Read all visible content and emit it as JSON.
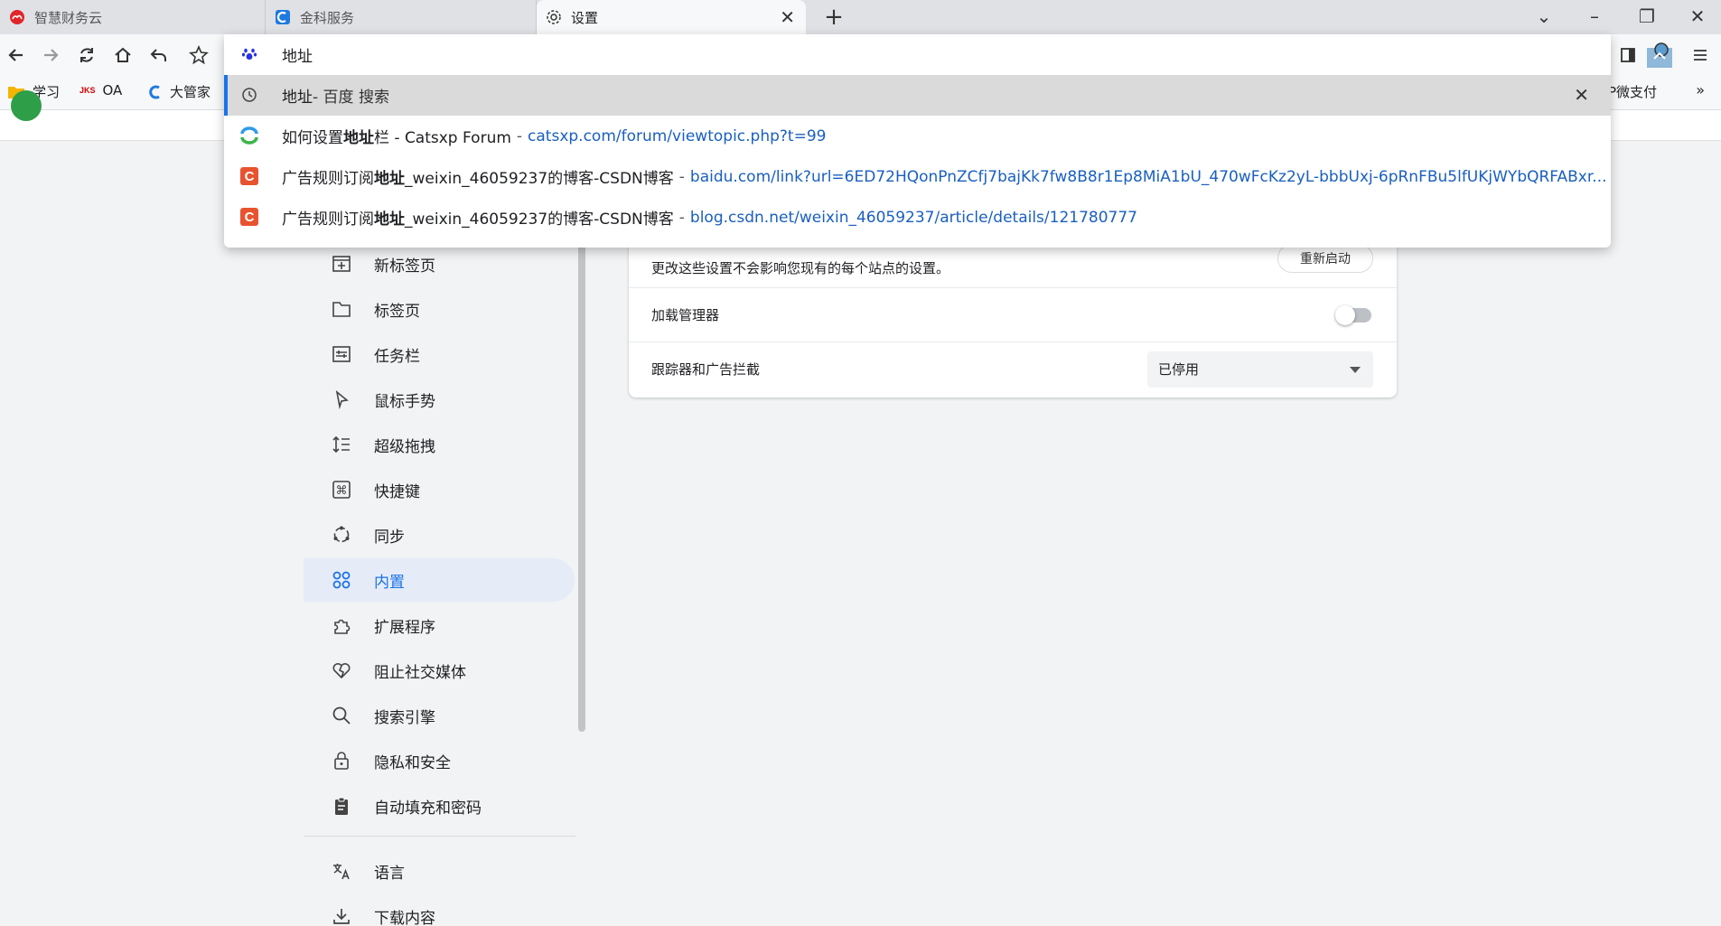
{
  "tabs": [
    {
      "title": "智慧财务云",
      "icon": "cloud-logo-icon"
    },
    {
      "title": "金科服务",
      "icon": "kingdee-logo-icon"
    },
    {
      "title": "设置",
      "icon": "gear-icon",
      "active": true
    }
  ],
  "toolbar": {
    "back": "back-icon",
    "forward": "forward-icon",
    "reload": "reload-icon",
    "home": "home-icon",
    "undo": "undo-icon",
    "star": "star-icon"
  },
  "bookmarks": [
    {
      "label": "学习",
      "icon": "folder-icon"
    },
    {
      "label": "OA",
      "icon": "jks-logo-icon",
      "badge": "JKS"
    },
    {
      "label": "大管家",
      "icon": "kingdee-logo-icon"
    },
    {
      "label": "P微支付",
      "icon": "partial"
    }
  ],
  "bookmarks_more": "»",
  "omnibox": {
    "input_text": "地址",
    "suggestions": [
      {
        "icon": "history-icon",
        "prefix": "地址",
        "title": " - 百度 搜索",
        "url": "",
        "selected": true
      },
      {
        "icon": "catsxp-logo-icon",
        "prefix": "如何设置",
        "bold": "地址",
        "title": "栏 - Catsxp Forum",
        "url": "catsxp.com/forum/viewtopic.php?t=99"
      },
      {
        "icon": "csdn-logo-icon",
        "prefix": "广告规则订阅",
        "bold": "地址",
        "title": "_weixin_46059237的博客-CSDN博客",
        "url": "baidu.com/link?url=6ED72HQonPnZCfj7bajKk7fw8B8r1Ep8MiA1bU_470wFcKz2yL-bbbUxj-6pRnFBu5lfUKjWYbQRFABxr..."
      },
      {
        "icon": "csdn-logo-icon",
        "prefix": "广告规则订阅",
        "bold": "地址",
        "title": "_weixin_46059237的博客-CSDN博客",
        "url": "blog.csdn.net/weixin_46059237/article/details/121780777"
      }
    ]
  },
  "sidebar": {
    "items": [
      {
        "label": "新标签页",
        "icon": "new-tab-icon"
      },
      {
        "label": "标签页",
        "icon": "tab-icon"
      },
      {
        "label": "任务栏",
        "icon": "taskbar-icon"
      },
      {
        "label": "鼠标手势",
        "icon": "cursor-icon"
      },
      {
        "label": "超级拖拽",
        "icon": "drag-icon"
      },
      {
        "label": "快捷键",
        "icon": "command-key-icon"
      },
      {
        "label": "同步",
        "icon": "sync-icon"
      },
      {
        "label": "内置",
        "icon": "builtin-icon",
        "active": true
      },
      {
        "label": "扩展程序",
        "icon": "puzzle-icon"
      },
      {
        "label": "阻止社交媒体",
        "icon": "heart-broken-icon"
      },
      {
        "label": "搜索引擎",
        "icon": "search-icon"
      },
      {
        "label": "隐私和安全",
        "icon": "lock-icon"
      },
      {
        "label": "自动填充和密码",
        "icon": "clipboard-icon"
      },
      {
        "label": "语言",
        "icon": "translate-icon"
      },
      {
        "label": "下载内容",
        "icon": "download-icon"
      }
    ]
  },
  "card": {
    "desc": "更改这些设置不会影响您现有的每个站点的设置。",
    "restart_label": "重新启动",
    "download_manager_label": "加载管理器",
    "download_manager_on": false,
    "tracker_label": "跟踪器和广告拦截",
    "tracker_value": "已停用"
  },
  "colors": {
    "accent": "#1a73e8",
    "link": "#1a5fc0",
    "sidebar_active_bg": "#e6ecf7",
    "csdn": "#e8532f"
  }
}
